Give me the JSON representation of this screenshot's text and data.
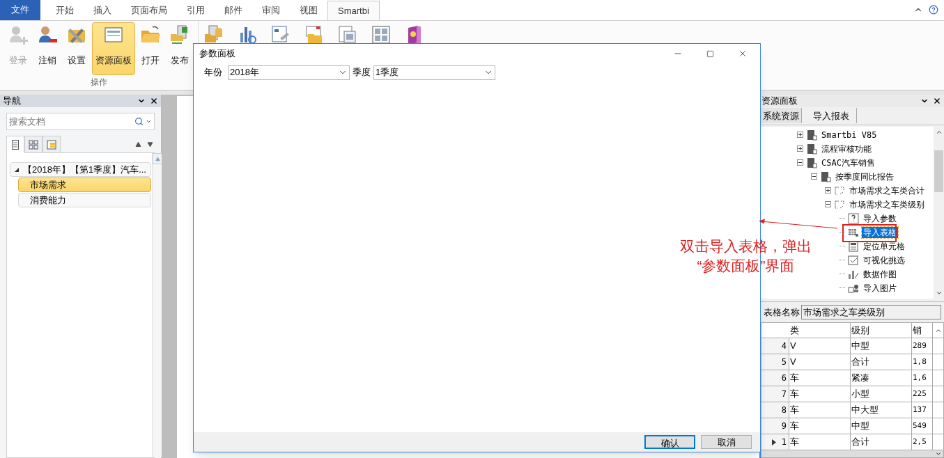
{
  "ribbon_tabs": [
    {
      "label": "文件",
      "kind": "file",
      "selected": false
    },
    {
      "label": "开始",
      "kind": "tab",
      "selected": false
    },
    {
      "label": "插入",
      "kind": "tab",
      "selected": false
    },
    {
      "label": "页面布局",
      "kind": "tab",
      "selected": false
    },
    {
      "label": "引用",
      "kind": "tab",
      "selected": false
    },
    {
      "label": "邮件",
      "kind": "tab",
      "selected": false
    },
    {
      "label": "审阅",
      "kind": "tab",
      "selected": false
    },
    {
      "label": "视图",
      "kind": "tab",
      "selected": false
    },
    {
      "label": "Smartbi",
      "kind": "tab",
      "selected": true
    }
  ],
  "ribbon": {
    "group_label": "操作",
    "buttons": [
      {
        "label": "登录",
        "disabled": true,
        "selected": false
      },
      {
        "label": "注销",
        "disabled": false,
        "selected": false
      },
      {
        "label": "设置",
        "disabled": false,
        "selected": false
      },
      {
        "label": "资源面板",
        "disabled": false,
        "selected": true
      },
      {
        "label": "打开",
        "disabled": false,
        "selected": false
      },
      {
        "label": "发布",
        "disabled": false,
        "selected": false
      }
    ]
  },
  "navigation": {
    "title": "导航",
    "search": {
      "placeholder": "搜索文档"
    },
    "view_tabs": [
      {
        "selected": true
      },
      {
        "selected": false
      },
      {
        "selected": false
      }
    ],
    "tree": [
      {
        "label": "【2018年】【第1季度】汽车...",
        "expanded": true,
        "selected": false,
        "children": [
          {
            "label": "市场需求",
            "selected": true
          },
          {
            "label": "消费能力",
            "selected": false
          }
        ]
      }
    ]
  },
  "resource_panel": {
    "title": "资源面板",
    "tabs": [
      {
        "label": "系统资源",
        "selected": true
      },
      {
        "label": "导入报表",
        "selected": false
      }
    ],
    "tree": [
      {
        "label": "Smartbi V85",
        "kind": "folder",
        "expanded": false,
        "selected": false
      },
      {
        "label": "流程审核功能",
        "kind": "folder",
        "expanded": false,
        "selected": false
      },
      {
        "label": "CSAC汽车销售",
        "kind": "folder",
        "expanded": true,
        "selected": false,
        "children": [
          {
            "label": "按季度同比报告",
            "kind": "folder",
            "expanded": true,
            "selected": false,
            "children": [
              {
                "label": "市场需求之车类合计",
                "kind": "report",
                "expanded": false,
                "selected": false
              },
              {
                "label": "市场需求之车类级别",
                "kind": "report",
                "expanded": true,
                "selected": false,
                "children": [
                  {
                    "label": "导入参数",
                    "kind": "param",
                    "selected": false
                  },
                  {
                    "label": "导入表格",
                    "kind": "table",
                    "selected": true
                  },
                  {
                    "label": "定位单元格",
                    "kind": "cell",
                    "selected": false
                  },
                  {
                    "label": "可视化挑选",
                    "kind": "filter",
                    "selected": false
                  },
                  {
                    "label": "数据作图",
                    "kind": "chart",
                    "selected": false
                  },
                  {
                    "label": "导入图片",
                    "kind": "image",
                    "selected": false
                  }
                ]
              }
            ]
          }
        ]
      }
    ],
    "table_name": {
      "label": "表格名称",
      "value": "市场需求之车类级别"
    },
    "table": {
      "columns": [
        "类",
        "级别",
        "销"
      ],
      "rows": [
        {
          "number": "4",
          "cells": [
            "V",
            "中型",
            "289"
          ],
          "current": false
        },
        {
          "number": "5",
          "cells": [
            "V",
            "合计",
            "1,8"
          ],
          "current": false
        },
        {
          "number": "6",
          "cells": [
            "车",
            "紧凑",
            "1,6"
          ],
          "current": false
        },
        {
          "number": "7",
          "cells": [
            "车",
            "小型",
            "225"
          ],
          "current": false
        },
        {
          "number": "8",
          "cells": [
            "车",
            "中大型",
            "137"
          ],
          "current": false
        },
        {
          "number": "9",
          "cells": [
            "车",
            "中型",
            "549"
          ],
          "current": false
        },
        {
          "number": "1",
          "cells": [
            "车",
            "合计",
            "2,5"
          ],
          "current": true
        }
      ]
    }
  },
  "dialog": {
    "title": "参数面板",
    "params": [
      {
        "label": "年份",
        "value": "2018年"
      },
      {
        "label": "季度",
        "value": "1季度"
      }
    ],
    "buttons": [
      {
        "label": "确认",
        "primary": true
      },
      {
        "label": "取消",
        "primary": false
      }
    ]
  },
  "annotation": {
    "lines": [
      "双击导入表格，弹出",
      "“参数面板”界面"
    ]
  }
}
